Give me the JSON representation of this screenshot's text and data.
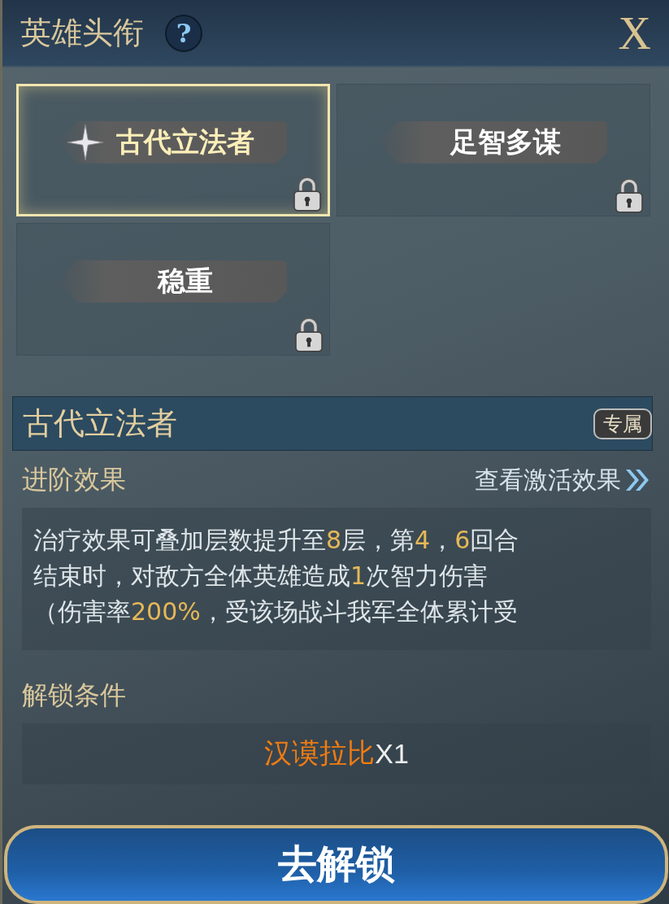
{
  "window": {
    "title": "英雄头衔",
    "help": "?",
    "close": "X"
  },
  "titles": [
    {
      "label": "古代立法者",
      "selected": true,
      "locked": true
    },
    {
      "label": "足智多谋",
      "selected": false,
      "locked": true
    },
    {
      "label": "稳重",
      "selected": false,
      "locked": true
    }
  ],
  "detail": {
    "name": "古代立法者",
    "tag": "专属"
  },
  "advanced": {
    "heading": "进阶效果",
    "link": "查看激活效果",
    "lines": [
      [
        {
          "text": "治疗效果可叠加层数提升至",
          "highlight": false
        },
        {
          "text": "8",
          "highlight": true
        },
        {
          "text": "层，第",
          "highlight": false
        },
        {
          "text": "4",
          "highlight": true
        },
        {
          "text": "，",
          "highlight": false
        },
        {
          "text": "6",
          "highlight": true
        },
        {
          "text": "回合",
          "highlight": false
        }
      ],
      [
        {
          "text": "结束时，对敌方全体英雄造成",
          "highlight": false
        },
        {
          "text": "1",
          "highlight": true
        },
        {
          "text": "次智力伤害",
          "highlight": false
        }
      ],
      [
        {
          "text": "（伤害率",
          "highlight": false
        },
        {
          "text": "200%",
          "highlight": true
        },
        {
          "text": "，受该场战斗我军全体累计受",
          "highlight": false
        }
      ]
    ]
  },
  "unlock": {
    "heading": "解锁条件",
    "item": "汉谟拉比",
    "count": "X1"
  },
  "button": {
    "label": "去解锁"
  }
}
